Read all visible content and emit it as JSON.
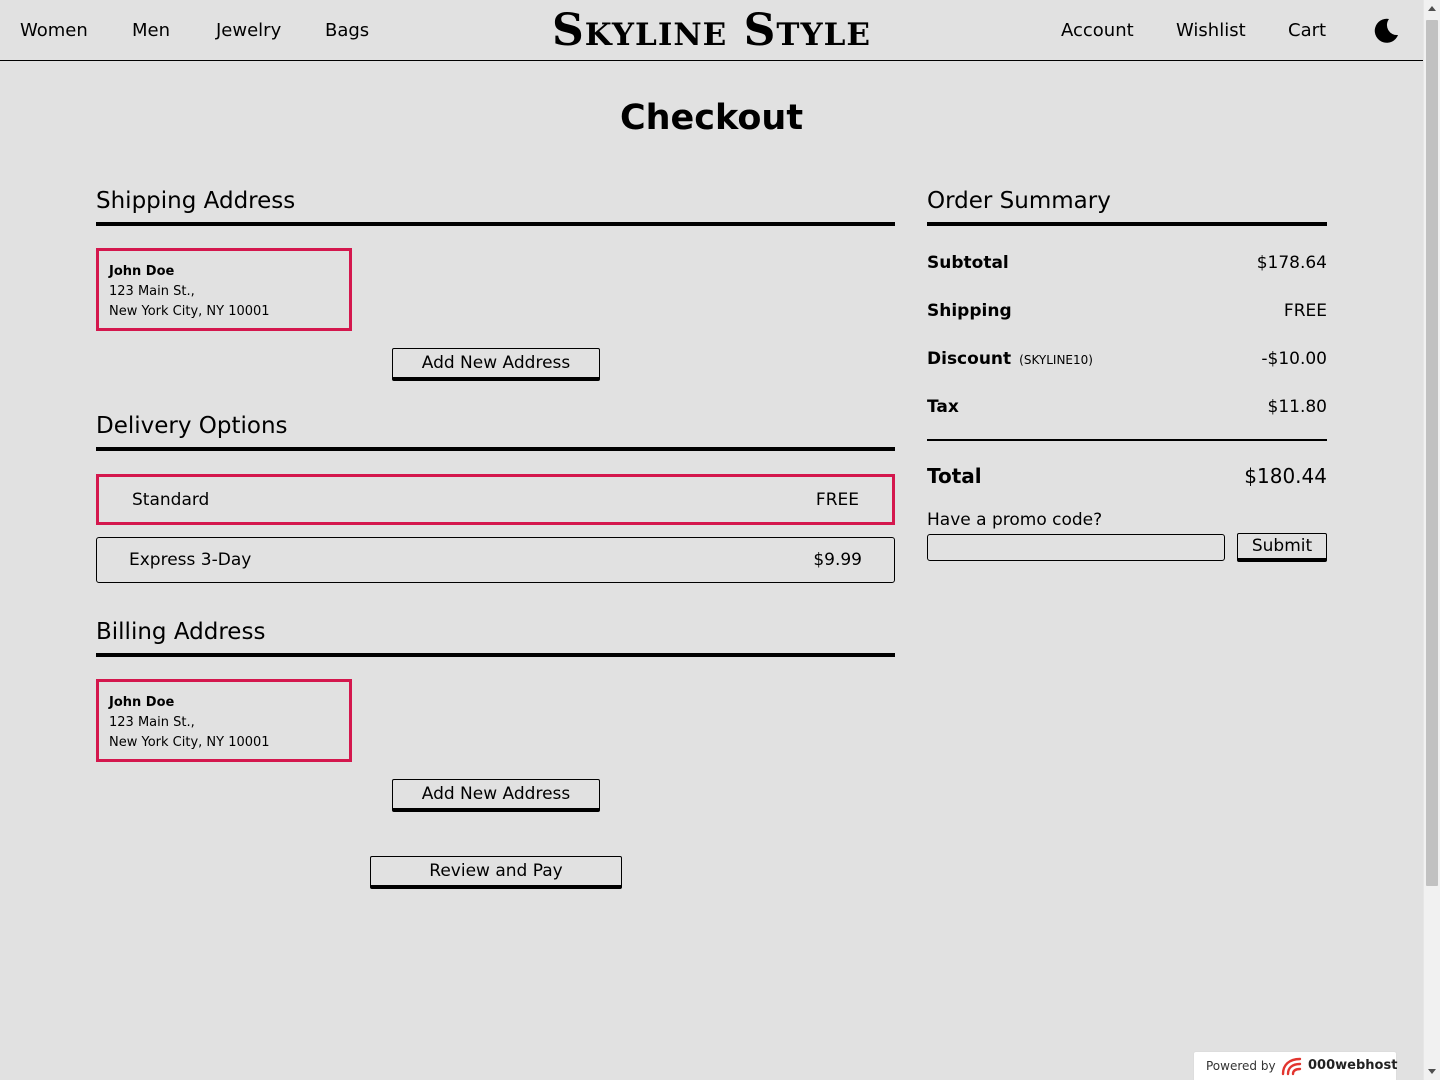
{
  "header": {
    "nav_left": [
      "Women",
      "Men",
      "Jewelry",
      "Bags"
    ],
    "logo": "Skyline Style",
    "nav_right": [
      "Account",
      "Wishlist",
      "Cart"
    ],
    "theme_icon": "moon-icon"
  },
  "page_title": "Checkout",
  "shipping": {
    "heading": "Shipping Address",
    "address": {
      "name": "John Doe",
      "line1": "123 Main St.,",
      "line2": "New York City, NY 10001"
    },
    "add_button": "Add New Address"
  },
  "delivery": {
    "heading": "Delivery Options",
    "options": [
      {
        "label": "Standard",
        "price": "FREE",
        "selected": true
      },
      {
        "label": "Express 3-Day",
        "price": "$9.99",
        "selected": false
      }
    ]
  },
  "billing": {
    "heading": "Billing Address",
    "address": {
      "name": "John Doe",
      "line1": "123 Main St.,",
      "line2": "New York City, NY 10001"
    },
    "add_button": "Add New Address"
  },
  "review_button": "Review and Pay",
  "summary": {
    "heading": "Order Summary",
    "subtotal_label": "Subtotal",
    "subtotal": "$178.64",
    "shipping_label": "Shipping",
    "shipping": "FREE",
    "discount_label": "Discount",
    "discount_code": "(SKYLINE10)",
    "discount": "-$10.00",
    "tax_label": "Tax",
    "tax": "$11.80",
    "total_label": "Total",
    "total": "$180.44",
    "promo_label": "Have a promo code?",
    "promo_value": "",
    "submit_label": "Submit"
  },
  "badge": {
    "powered": "Powered by",
    "brand": "000webhost"
  },
  "colors": {
    "background": "#e1e1e1",
    "accent": "#d4174d"
  }
}
